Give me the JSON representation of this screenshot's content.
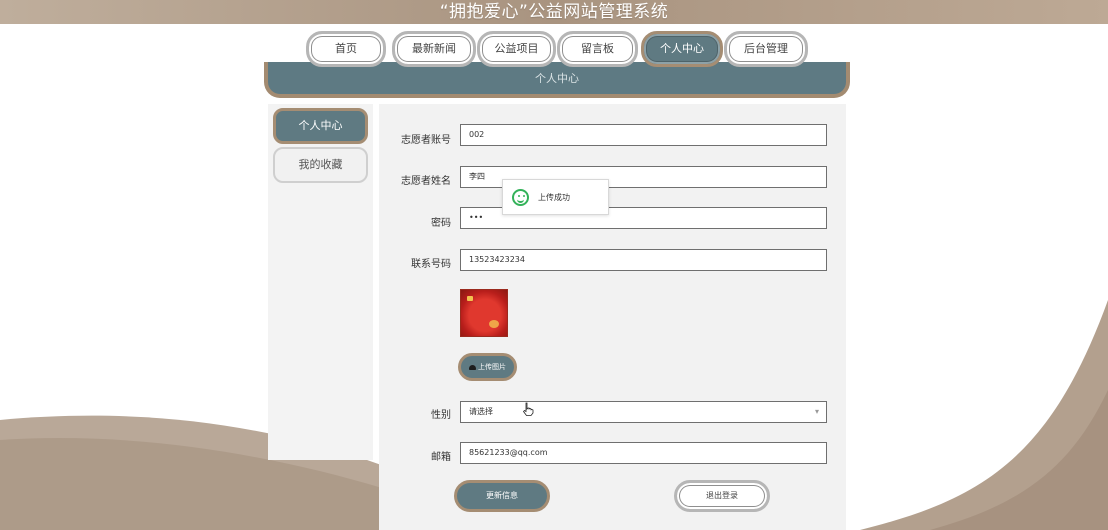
{
  "site": {
    "title": "“拥抱爱心”公益网站管理系统"
  },
  "nav": {
    "items": [
      {
        "label": "首页"
      },
      {
        "label": "最新新闻"
      },
      {
        "label": "公益项目"
      },
      {
        "label": "留言板"
      },
      {
        "label": "个人中心"
      },
      {
        "label": "后台管理"
      }
    ],
    "active": "个人中心"
  },
  "banner": {
    "title": "个人中心"
  },
  "sidebar": {
    "items": [
      {
        "label": "个人中心"
      },
      {
        "label": "我的收藏"
      }
    ]
  },
  "form": {
    "account": {
      "label": "志愿者账号",
      "value": "002"
    },
    "name": {
      "label": "志愿者姓名",
      "value": "李四"
    },
    "password": {
      "label": "密码",
      "value": "•••"
    },
    "phone": {
      "label": "联系号码",
      "value": "13523423234"
    },
    "upload_label": "上传图片",
    "gender": {
      "label": "性别",
      "value": "请选择"
    },
    "email": {
      "label": "邮箱",
      "value": "85621233@qq.com"
    },
    "update_label": "更新信息",
    "logout_label": "退出登录"
  },
  "toast": {
    "message": "上传成功",
    "icon": "smile-icon"
  },
  "colors": {
    "accent": "#5f7a82",
    "border_accent": "#a58d73",
    "topbar": "#a99480",
    "success": "#34b25a"
  }
}
